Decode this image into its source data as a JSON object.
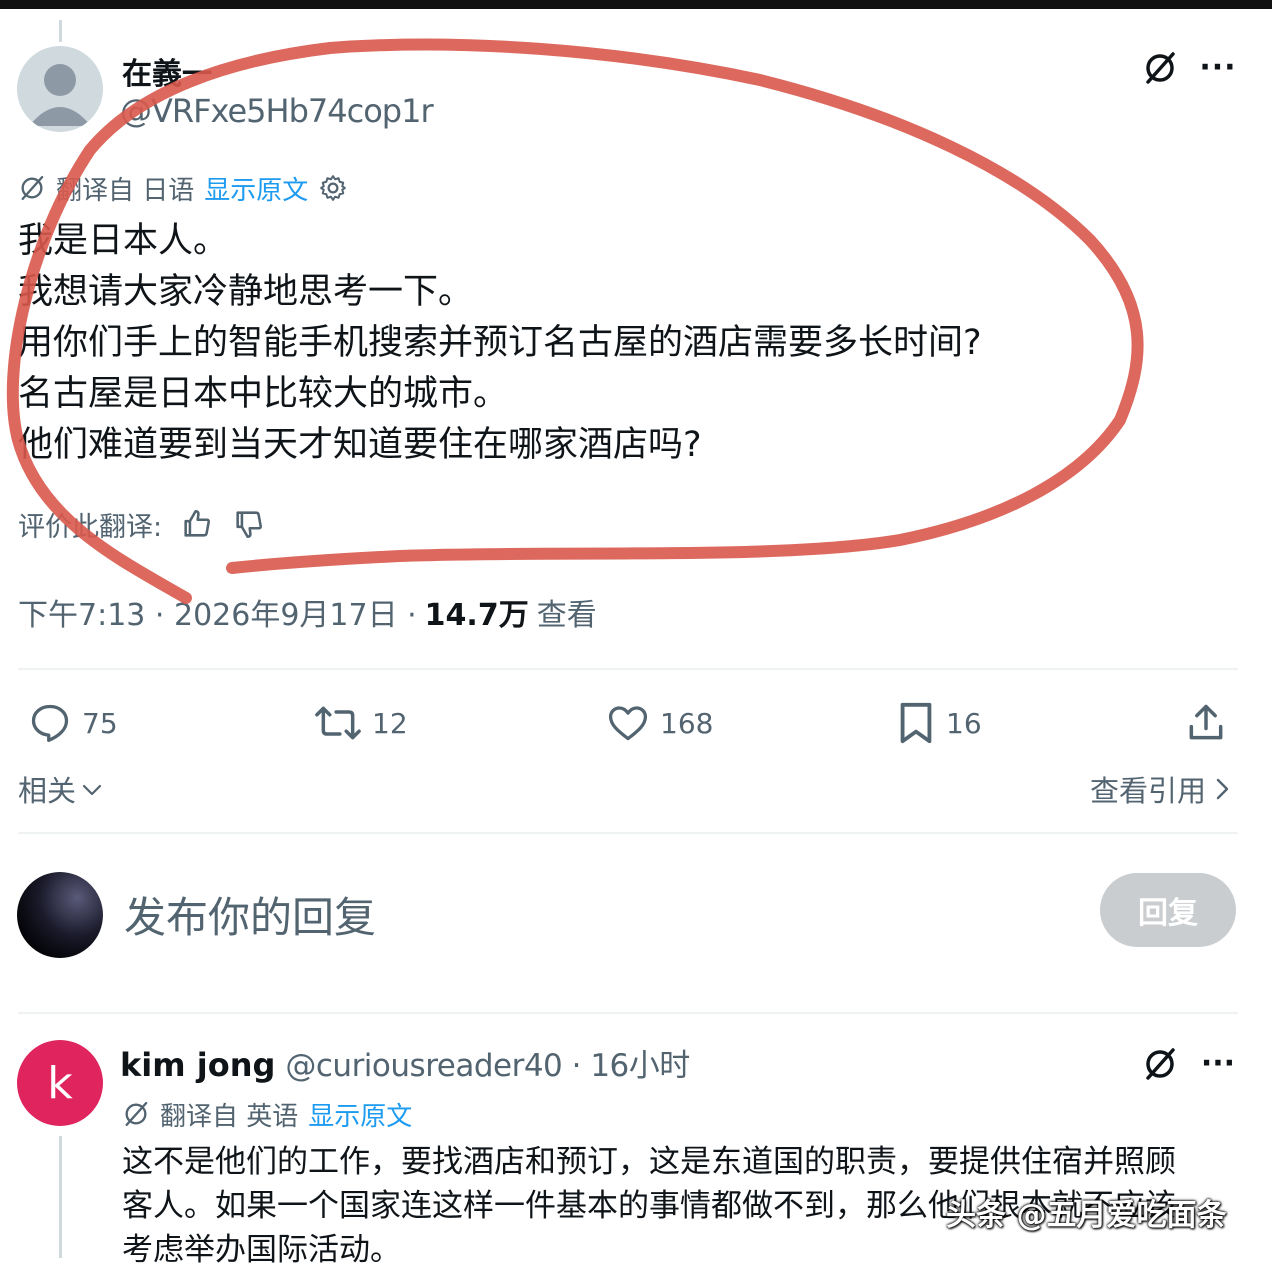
{
  "tweet": {
    "author_name": "在義一",
    "author_handle": "@VRFxe5Hb74cop1r",
    "translate": {
      "label": "翻译自 日语",
      "show_original": "显示原文"
    },
    "lines": [
      "我是日本人。",
      "我想请大家冷静地思考一下。",
      "用你们手上的智能手机搜索并预订名古屋的酒店需要多长时间?",
      "名古屋是日本中比较大的城市。",
      "他们难道要到当天才知道要住在哪家酒店吗?"
    ],
    "rate_label": "评价此翻译:",
    "time": "下午7:13 · 2026年9月17日 · ",
    "views_count": "14.7万",
    "views_label": "查看",
    "actions": {
      "replies": "75",
      "retweets": "12",
      "likes": "168",
      "bookmarks": "16"
    },
    "related": "相关",
    "view_quotes": "查看引用"
  },
  "compose": {
    "placeholder": "发布你的回复",
    "reply_button": "回复"
  },
  "reply": {
    "avatar_letter": "k",
    "name": "kim jong",
    "handle_time": "@curiousreader40 · 16小时",
    "translate": {
      "label": "翻译自 英语",
      "show_original": "显示原文"
    },
    "lines": [
      "这不是他们的工作，要找酒店和预订，这是东道国的职责，要提供住宿并照顾",
      "客人。如果一个国家连这样一件基本的事情都做不到，那么他们根本就不应该",
      "考虑举办国际活动。"
    ]
  },
  "watermark": "头条 @五月爱吃面条",
  "icons": [
    "grok-icon",
    "more-icon",
    "gear-icon",
    "thumbs-up-icon",
    "thumbs-down-icon",
    "reply-icon",
    "retweet-icon",
    "like-icon",
    "bookmark-icon",
    "share-icon",
    "chevron-down-icon",
    "chevron-right-icon"
  ],
  "colors": {
    "link": "#1d9bf0",
    "secondary_text": "#536471",
    "annotation": "#d9594c",
    "reply_avatar": "#e0245e"
  }
}
